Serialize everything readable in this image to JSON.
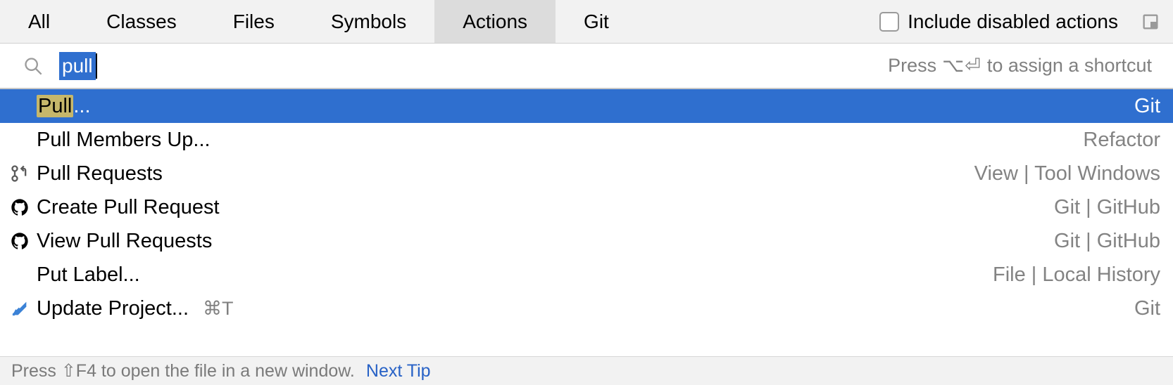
{
  "tabs": {
    "all": "All",
    "classes": "Classes",
    "files": "Files",
    "symbols": "Symbols",
    "actions": "Actions",
    "git": "Git",
    "active_index": 4
  },
  "include_disabled": {
    "label": "Include disabled actions",
    "checked": false
  },
  "search": {
    "query": "pull",
    "hint_prefix": "Press",
    "hint_shortcut": "⌥⏎",
    "hint_suffix": "to assign a shortcut"
  },
  "results": [
    {
      "icon": "none",
      "highlight": "Pull",
      "rest": "...",
      "shortcut": "",
      "context": "Git",
      "selected": true
    },
    {
      "icon": "none",
      "highlight": "",
      "rest": "Pull Members Up...",
      "shortcut": "",
      "context": "Refactor",
      "selected": false
    },
    {
      "icon": "pull-request",
      "highlight": "",
      "rest": "Pull Requests",
      "shortcut": "",
      "context": "View | Tool Windows",
      "selected": false
    },
    {
      "icon": "github",
      "highlight": "",
      "rest": "Create Pull Request",
      "shortcut": "",
      "context": "Git | GitHub",
      "selected": false
    },
    {
      "icon": "github",
      "highlight": "",
      "rest": "View Pull Requests",
      "shortcut": "",
      "context": "Git | GitHub",
      "selected": false
    },
    {
      "icon": "none",
      "highlight": "",
      "rest": "Put Label...",
      "shortcut": "",
      "context": "File | Local History",
      "selected": false
    },
    {
      "icon": "update",
      "highlight": "",
      "rest": "Update Project...",
      "shortcut": "⌘T",
      "context": "Git",
      "selected": false
    }
  ],
  "status": {
    "tip": "Press ⇧F4 to open the file in a new window.",
    "link": "Next Tip"
  }
}
